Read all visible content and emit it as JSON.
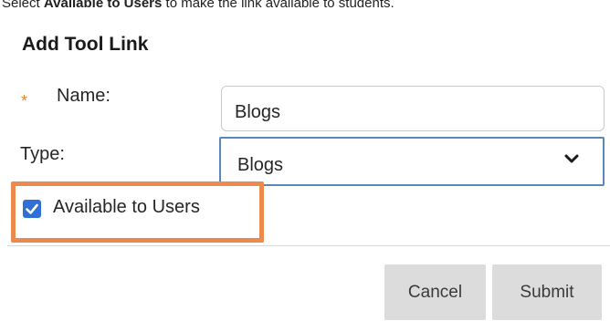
{
  "caption": {
    "prefix": "Select ",
    "bold": "Available to Users",
    "suffix": " to make the link available to students."
  },
  "dialog": {
    "title": "Add Tool Link"
  },
  "form": {
    "name_required_marker": "*",
    "name_label": "Name:",
    "name_value": "Blogs",
    "type_label": "Type:",
    "type_value": "Blogs",
    "available_label": "Available to Users",
    "available_checked": true
  },
  "buttons": {
    "cancel_label": "Cancel",
    "submit_label": "Submit"
  },
  "colors": {
    "highlight_box": "#ec8a4d",
    "required_star": "#e0862e",
    "checkbox": "#2f6fd6",
    "select_border": "#5a86b8",
    "button_bg": "#dcdcdc"
  },
  "icons": {
    "select_arrow": "chevron-down-icon",
    "checkbox_mark": "checkmark-icon"
  }
}
